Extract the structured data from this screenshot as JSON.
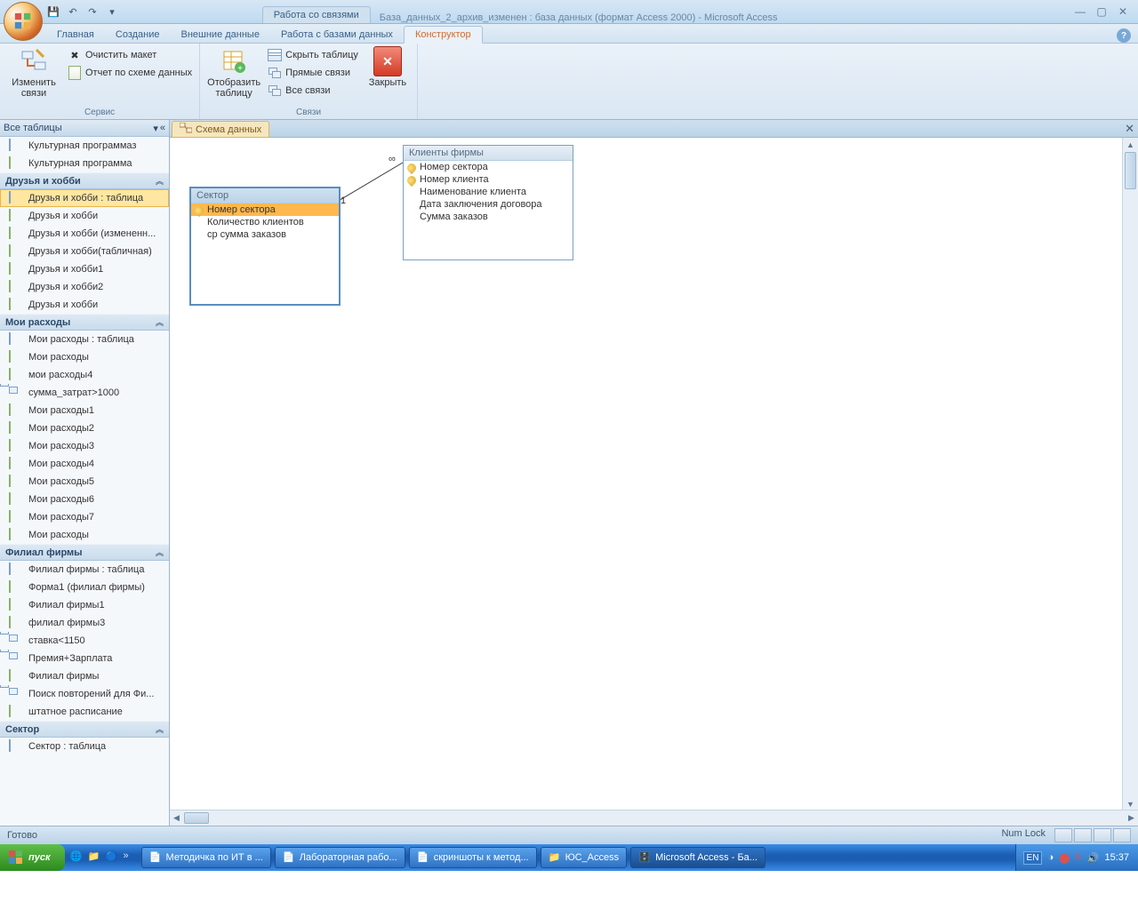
{
  "window": {
    "context_tab": "Работа со связями",
    "title": "База_данных_2_архив_изменен : база данных (формат Access 2000) - Microsoft Access"
  },
  "ribbon_tabs": {
    "t0": "Главная",
    "t1": "Создание",
    "t2": "Внешние данные",
    "t3": "Работа с базами данных",
    "t4": "Конструктор"
  },
  "ribbon": {
    "group_service": "Сервис",
    "group_links": "Связи",
    "edit_links": "Изменить связи",
    "clear_layout": "Очистить макет",
    "rel_report": "Отчет по схеме данных",
    "show_table": "Отобразить таблицу",
    "hide_table": "Скрыть таблицу",
    "direct_links": "Прямые связи",
    "all_links": "Все связи",
    "close": "Закрыть"
  },
  "nav": {
    "header": "Все таблицы",
    "groups": [
      {
        "title": "",
        "items": [
          {
            "label": "Культурная программаз",
            "icon": "table"
          },
          {
            "label": "Культурная программа",
            "icon": "form"
          }
        ]
      },
      {
        "title": "Друзья и хобби",
        "items": [
          {
            "label": "Друзья и хобби : таблица",
            "icon": "table",
            "selected": true
          },
          {
            "label": "Друзья и хобби",
            "icon": "form"
          },
          {
            "label": "Друзья и хобби (измененн...",
            "icon": "form"
          },
          {
            "label": "Друзья и хобби(табличная)",
            "icon": "form"
          },
          {
            "label": "Друзья и хобби1",
            "icon": "form"
          },
          {
            "label": "Друзья и хобби2",
            "icon": "form"
          },
          {
            "label": "Друзья и хобби",
            "icon": "report"
          }
        ]
      },
      {
        "title": "Мои расходы",
        "items": [
          {
            "label": "Мои расходы : таблица",
            "icon": "table"
          },
          {
            "label": "Мои расходы",
            "icon": "form"
          },
          {
            "label": "мои расходы4",
            "icon": "form"
          },
          {
            "label": "сумма_затрат>1000",
            "icon": "query"
          },
          {
            "label": "Мои расходы1",
            "icon": "report"
          },
          {
            "label": "Мои расходы2",
            "icon": "report"
          },
          {
            "label": "Мои расходы3",
            "icon": "report"
          },
          {
            "label": "Мои расходы4",
            "icon": "report"
          },
          {
            "label": "Мои расходы5",
            "icon": "report"
          },
          {
            "label": "Мои расходы6",
            "icon": "report"
          },
          {
            "label": "Мои расходы7",
            "icon": "report"
          },
          {
            "label": "Мои расходы",
            "icon": "report"
          }
        ]
      },
      {
        "title": "Филиал фирмы",
        "items": [
          {
            "label": "Филиал фирмы : таблица",
            "icon": "table"
          },
          {
            "label": "Форма1 (филиал фирмы)",
            "icon": "form"
          },
          {
            "label": "Филиал фирмы1",
            "icon": "form"
          },
          {
            "label": "филиал фирмы3",
            "icon": "form"
          },
          {
            "label": "ставка<1150",
            "icon": "query"
          },
          {
            "label": "Премия+Зарплата",
            "icon": "query"
          },
          {
            "label": "Филиал фирмы",
            "icon": "report"
          },
          {
            "label": "Поиск повторений для Фи...",
            "icon": "query"
          },
          {
            "label": "штатное расписание",
            "icon": "report"
          }
        ]
      },
      {
        "title": "Сектор",
        "items": [
          {
            "label": "Сектор : таблица",
            "icon": "table"
          }
        ]
      }
    ]
  },
  "doc_tab": "Схема данных",
  "tables": {
    "sector": {
      "title": "Сектор",
      "fields": [
        {
          "label": "Номер сектора",
          "key": true,
          "selected": true
        },
        {
          "label": "Количество клиентов"
        },
        {
          "label": "ср сумма заказов"
        }
      ]
    },
    "clients": {
      "title": "Клиенты фирмы",
      "fields": [
        {
          "label": "Номер сектора",
          "key": true
        },
        {
          "label": "Номер клиента",
          "key": true
        },
        {
          "label": "Наименование клиента"
        },
        {
          "label": "Дата заключения договора"
        },
        {
          "label": "Сумма заказов"
        }
      ]
    }
  },
  "rel": {
    "left": "1",
    "right": "∞"
  },
  "status": {
    "left": "Готово",
    "numlock": "Num Lock"
  },
  "taskbar": {
    "start": "пуск",
    "items": [
      {
        "label": "Методичка по ИТ в ..."
      },
      {
        "label": "Лабораторная рабо..."
      },
      {
        "label": "скриншоты к метод..."
      },
      {
        "label": "ЮС_Access"
      },
      {
        "label": "Microsoft Access - Ба...",
        "active": true
      }
    ],
    "lang": "EN",
    "time": "15:37"
  }
}
